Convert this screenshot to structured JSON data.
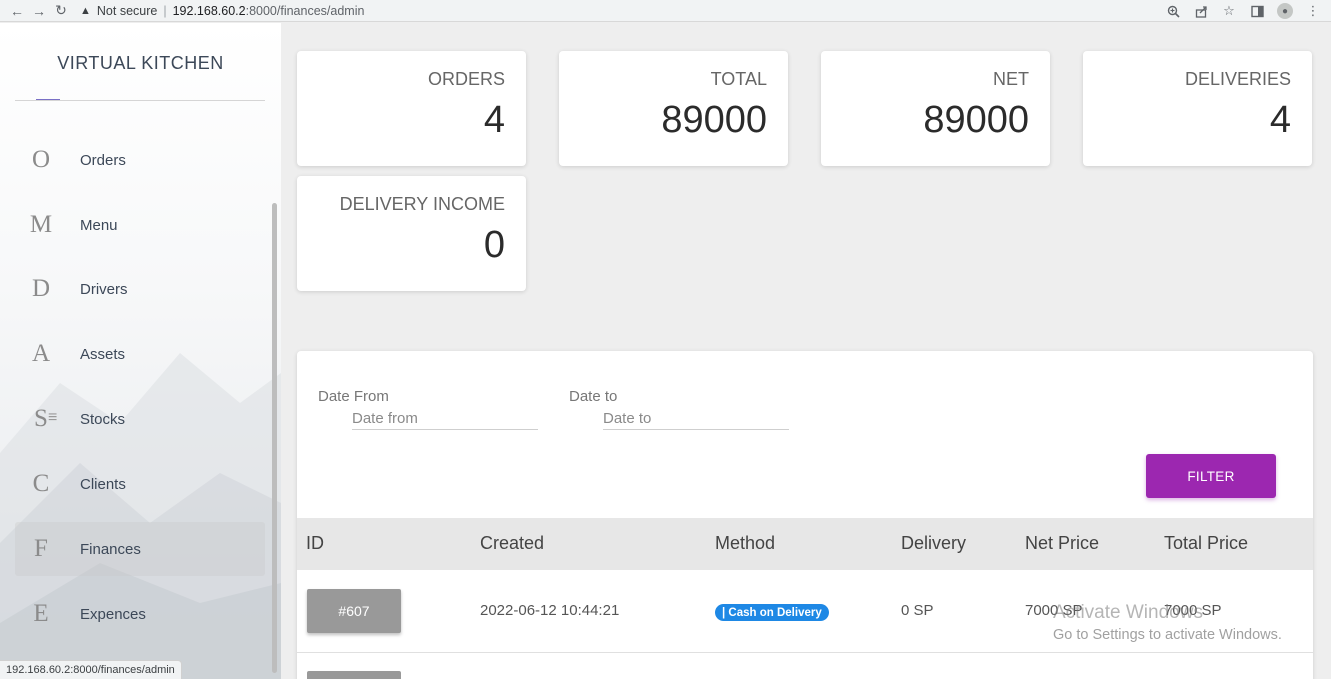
{
  "browser": {
    "not_secure": "Not secure",
    "separator": "|",
    "url_host": "192.168.60.2",
    "url_path": ":8000/finances/admin"
  },
  "sidebar": {
    "brand": "VIRTUAL KITCHEN",
    "items": [
      {
        "letter": "O",
        "label": "Orders"
      },
      {
        "letter": "M",
        "label": "Menu"
      },
      {
        "letter": "D",
        "label": "Drivers"
      },
      {
        "letter": "A",
        "label": "Assets"
      },
      {
        "letter": "S",
        "label": "Stocks"
      },
      {
        "letter": "C",
        "label": "Clients"
      },
      {
        "letter": "F",
        "label": "Finances"
      },
      {
        "letter": "E",
        "label": "Expences"
      }
    ]
  },
  "stats": {
    "orders": {
      "title": "ORDERS",
      "value": "4"
    },
    "total": {
      "title": "TOTAL",
      "value": "89000"
    },
    "net": {
      "title": "NET",
      "value": "89000"
    },
    "deliveries": {
      "title": "DELIVERIES",
      "value": "4"
    },
    "delivery_income": {
      "title": "DELIVERY INCOME",
      "value": "0"
    }
  },
  "filter": {
    "date_from_label": "Date From",
    "date_from_placeholder": "Date from",
    "date_to_label": "Date to",
    "date_to_placeholder": "Date to",
    "button": "FILTER"
  },
  "table": {
    "headers": [
      "ID",
      "Created",
      "Method",
      "Delivery",
      "Net Price",
      "Total Price"
    ],
    "rows": [
      {
        "id": "#607",
        "created": "2022-06-12 10:44:21",
        "method": "| Cash on Delivery",
        "delivery": "0 SP",
        "net_price": "7000 SP",
        "total_price": "7000 SP"
      }
    ]
  },
  "watermark": {
    "title": "Activate Windows",
    "subtitle": "Go to Settings to activate Windows."
  },
  "status_bar": "192.168.60.2:8000/finances/admin",
  "colors": {
    "filter_button": "#9c27b0",
    "method_badge": "#1e88e5",
    "id_button": "#999999"
  }
}
